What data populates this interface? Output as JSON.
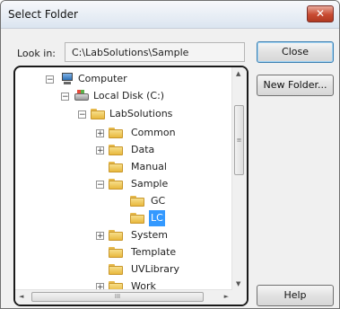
{
  "window": {
    "title": "Select Folder",
    "close_glyph": "✕"
  },
  "lookin": {
    "label": "Look in:",
    "value": "C:\\LabSolutions\\Sample"
  },
  "buttons": {
    "close": "Close",
    "new_folder": "New Folder...",
    "help": "Help"
  },
  "tree": [
    {
      "label": "Computer",
      "icon": "computer-icon",
      "expander": "−"
    },
    {
      "label": "Local Disk (C:)",
      "icon": "disk-icon",
      "expander": "−"
    },
    {
      "label": "LabSolutions",
      "icon": "folder-icon",
      "expander": "−"
    },
    {
      "label": "Common",
      "icon": "folder-icon",
      "expander": "+"
    },
    {
      "label": "Data",
      "icon": "folder-icon",
      "expander": "+"
    },
    {
      "label": "Manual",
      "icon": "folder-icon",
      "expander": ""
    },
    {
      "label": "Sample",
      "icon": "folder-icon",
      "expander": "−"
    },
    {
      "label": "GC",
      "icon": "folder-icon",
      "expander": ""
    },
    {
      "label": "LC",
      "icon": "folder-icon",
      "expander": "",
      "selected": true
    },
    {
      "label": "System",
      "icon": "folder-icon",
      "expander": "+"
    },
    {
      "label": "Template",
      "icon": "folder-icon",
      "expander": ""
    },
    {
      "label": "UVLibrary",
      "icon": "folder-icon",
      "expander": ""
    },
    {
      "label": "Work",
      "icon": "folder-icon",
      "expander": "+"
    }
  ],
  "scroll": {
    "up": "▲",
    "down": "▼",
    "left": "◄",
    "right": "►",
    "grip_v": "≡",
    "grip_h": "III"
  }
}
